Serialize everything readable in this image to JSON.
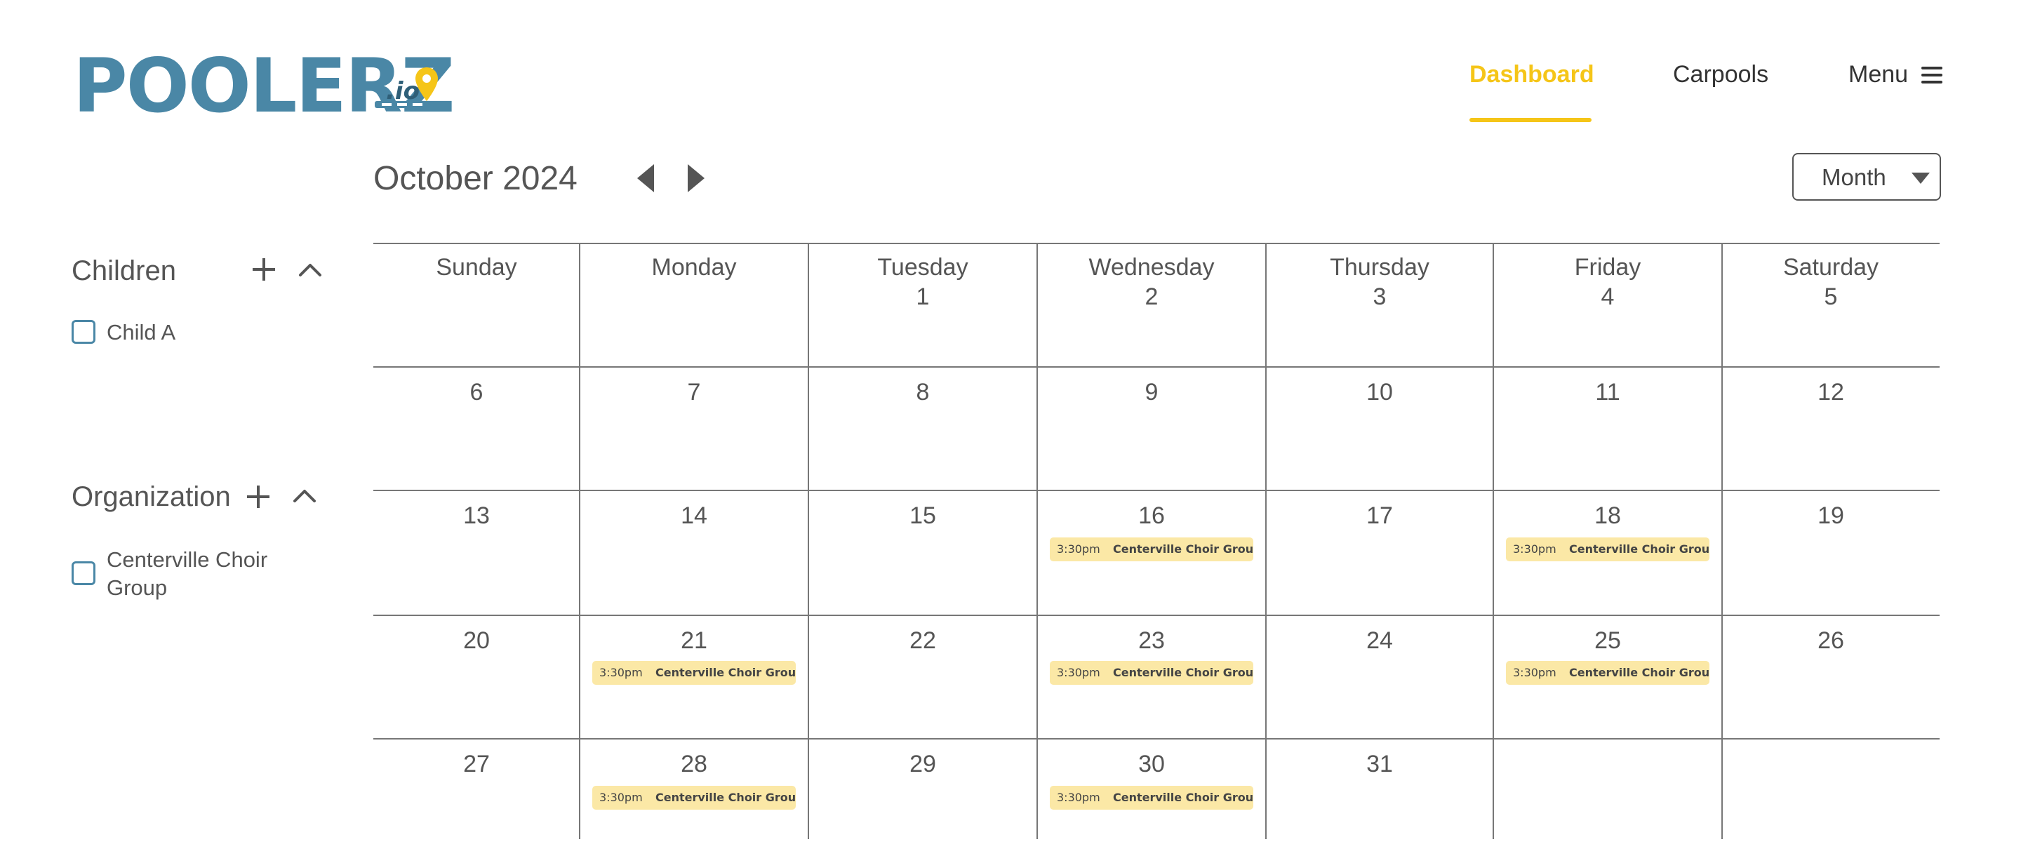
{
  "brand": {
    "logo_main": "POOLERZ",
    "logo_suffix": ".io"
  },
  "colors": {
    "brand_blue": "#4a87a6",
    "accent_yellow": "#f5c518",
    "event_bg": "#fbe8a6",
    "grid_line": "#777777"
  },
  "nav": {
    "links": [
      {
        "label": "Dashboard",
        "active": true
      },
      {
        "label": "Carpools",
        "active": false
      },
      {
        "label": "Menu",
        "icon": "hamburger-icon",
        "active": false
      }
    ]
  },
  "sidebar": {
    "children": {
      "title": "Children",
      "items": [
        {
          "label": "Child A",
          "checked": false
        }
      ]
    },
    "organization": {
      "title": "Organization",
      "items": [
        {
          "label": "Centerville Choir Group",
          "checked": false
        }
      ]
    }
  },
  "calendar": {
    "title": "October 2024",
    "view": "Month",
    "weekdays": [
      "Sunday",
      "Monday",
      "Tuesday",
      "Wednesday",
      "Thursday",
      "Friday",
      "Saturday"
    ],
    "weeks": [
      [
        {
          "day": ""
        },
        {
          "day": ""
        },
        {
          "day": "1"
        },
        {
          "day": "2"
        },
        {
          "day": "3"
        },
        {
          "day": "4"
        },
        {
          "day": "5"
        }
      ],
      [
        {
          "day": "6"
        },
        {
          "day": "7"
        },
        {
          "day": "8"
        },
        {
          "day": "9"
        },
        {
          "day": "10"
        },
        {
          "day": "11"
        },
        {
          "day": "12"
        }
      ],
      [
        {
          "day": "13"
        },
        {
          "day": "14"
        },
        {
          "day": "15"
        },
        {
          "day": "16",
          "events": [
            {
              "time": "3:30pm",
              "name": "Centerville Choir Group"
            }
          ]
        },
        {
          "day": "17"
        },
        {
          "day": "18",
          "events": [
            {
              "time": "3:30pm",
              "name": "Centerville Choir Group"
            }
          ]
        },
        {
          "day": "19"
        }
      ],
      [
        {
          "day": "20"
        },
        {
          "day": "21",
          "events": [
            {
              "time": "3:30pm",
              "name": "Centerville Choir Group"
            }
          ]
        },
        {
          "day": "22"
        },
        {
          "day": "23",
          "events": [
            {
              "time": "3:30pm",
              "name": "Centerville Choir Group"
            }
          ]
        },
        {
          "day": "24"
        },
        {
          "day": "25",
          "events": [
            {
              "time": "3:30pm",
              "name": "Centerville Choir Group"
            }
          ]
        },
        {
          "day": "26"
        }
      ],
      [
        {
          "day": "27"
        },
        {
          "day": "28",
          "events": [
            {
              "time": "3:30pm",
              "name": "Centerville Choir Group"
            }
          ]
        },
        {
          "day": "29"
        },
        {
          "day": "30",
          "events": [
            {
              "time": "3:30pm",
              "name": "Centerville Choir Group"
            }
          ]
        },
        {
          "day": "31"
        },
        {
          "day": ""
        },
        {
          "day": ""
        }
      ]
    ]
  }
}
